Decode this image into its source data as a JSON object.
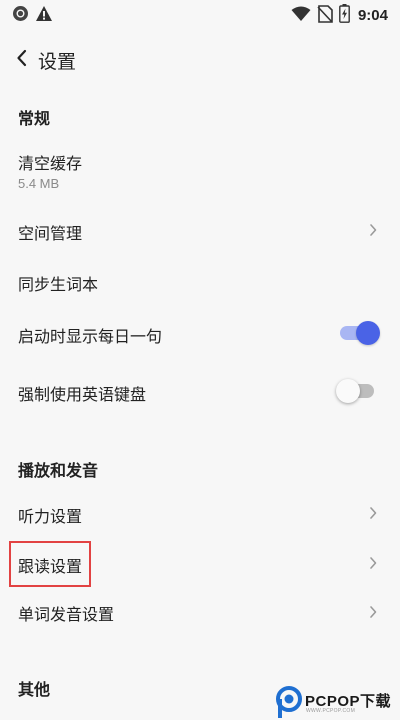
{
  "status_bar": {
    "time": "9:04",
    "icons_left": [
      "circle-status-icon",
      "warning-icon"
    ],
    "icons_right": [
      "wifi-icon",
      "no-sim-icon",
      "battery-charging-icon"
    ]
  },
  "header": {
    "back_icon": "chevron-left-icon",
    "title": "设置"
  },
  "sections": {
    "general": {
      "title": "常规",
      "items": {
        "clear_cache": {
          "label": "清空缓存",
          "sub": "5.4 MB"
        },
        "storage": {
          "label": "空间管理"
        },
        "sync_words": {
          "label": "同步生词本"
        },
        "daily_quote": {
          "label": "启动时显示每日一句",
          "toggle_on": true
        },
        "force_english_kb": {
          "label": "强制使用英语键盘",
          "toggle_on": false
        }
      }
    },
    "playback": {
      "title": "播放和发音",
      "items": {
        "listening": {
          "label": "听力设置"
        },
        "read_along": {
          "label": "跟读设置",
          "highlighted": true
        },
        "word_pron": {
          "label": "单词发音设置"
        }
      }
    },
    "other": {
      "title": "其他"
    }
  },
  "colors": {
    "accent": "#4a63e6",
    "accent_track": "#a9b6f3",
    "highlight_border": "#e24242",
    "background": "#f7f7f7",
    "text_primary": "#222222",
    "text_secondary": "#8a8a8a",
    "watermark_blue": "#1f6fd1"
  },
  "watermark": {
    "brand": "PCPOP下载",
    "tagline": "WWW.PCPOP.COM"
  }
}
